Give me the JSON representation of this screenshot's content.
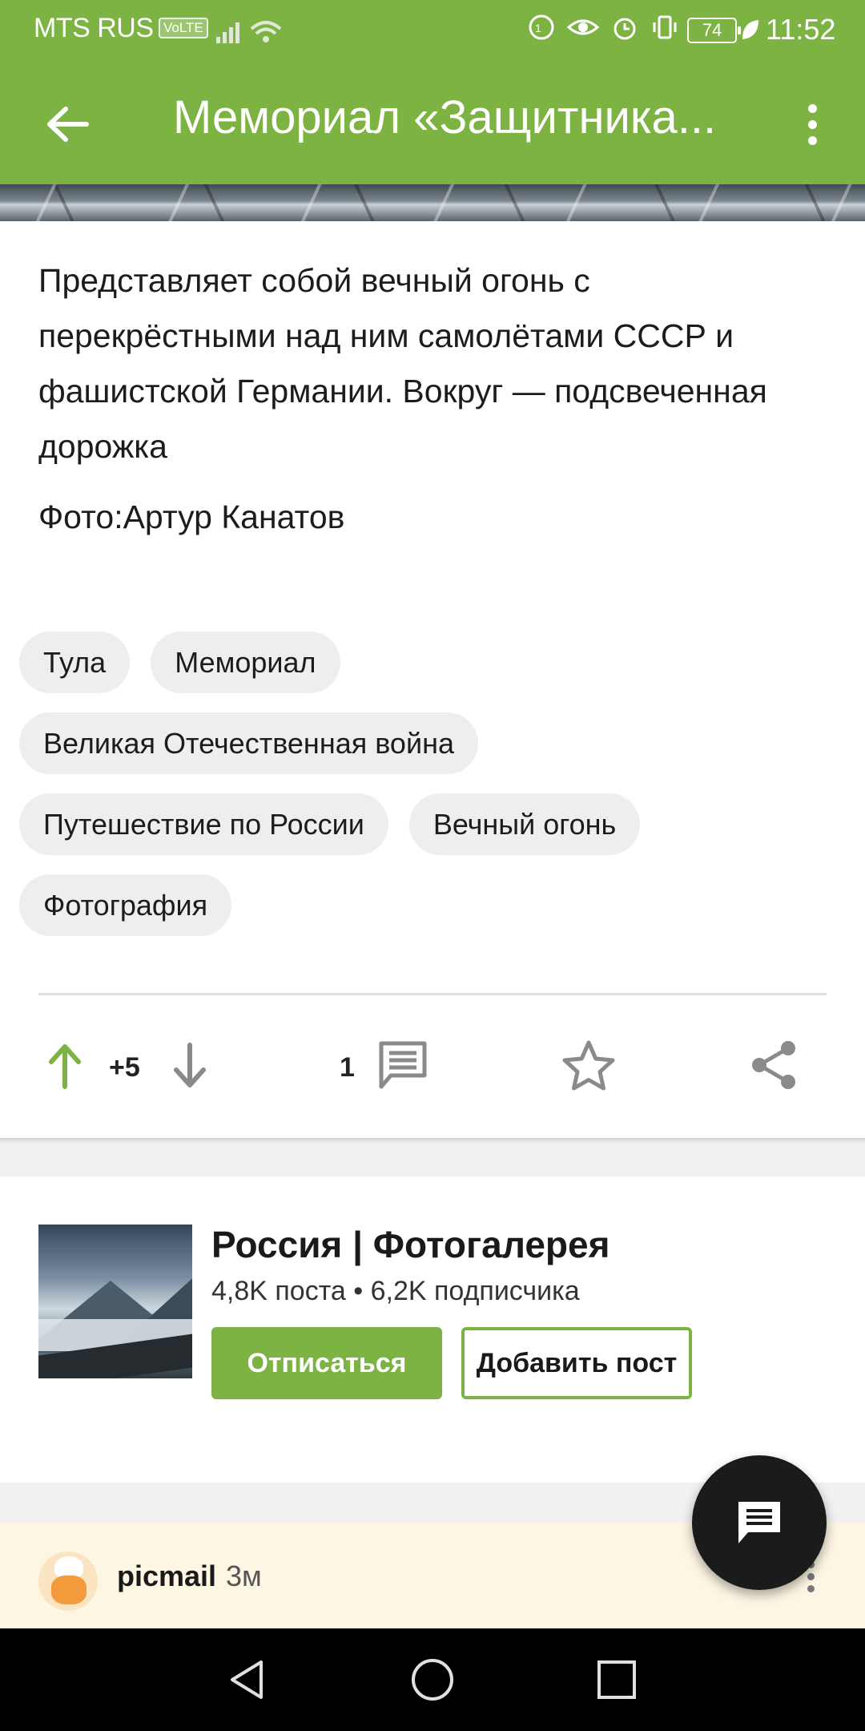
{
  "status_bar": {
    "carrier": "MTS RUS",
    "volte": "VoLTE",
    "battery": "74",
    "time": "11:52"
  },
  "app_bar": {
    "title": "Мемориал «Защитника..."
  },
  "post": {
    "description": "Представляет собой вечный огонь с перекрёстными над ним самолётами СССР и фашистской Германии. Вокруг — подсвеченная дорожка",
    "photo_credit": "Фото:Артур Канатов",
    "tags": [
      [
        "Тула",
        "Мемориал"
      ],
      [
        "Великая Отечественная война"
      ],
      [
        "Путешествие по России",
        "Вечный огонь"
      ],
      [
        "Фотография"
      ]
    ],
    "score": "+5",
    "comments_count": "1"
  },
  "community": {
    "name": "Россия | Фотогалерея",
    "stats": "4,8K поста • 6,2K подписчика",
    "unsubscribe_label": "Отписаться",
    "add_post_label": "Добавить пост"
  },
  "comment": {
    "user": "picmail",
    "time": "3м"
  },
  "colors": {
    "accent": "#7cb342",
    "upvote": "#7cb342",
    "icon_gray": "#8a8a8a",
    "comment_bg": "#fdf6e3"
  },
  "icons": [
    "back-arrow-icon",
    "more-vert-icon",
    "upvote-icon",
    "downvote-icon",
    "comment-icon",
    "star-icon",
    "share-icon",
    "chat-icon",
    "nav-back-icon",
    "nav-home-icon",
    "nav-recent-icon"
  ]
}
